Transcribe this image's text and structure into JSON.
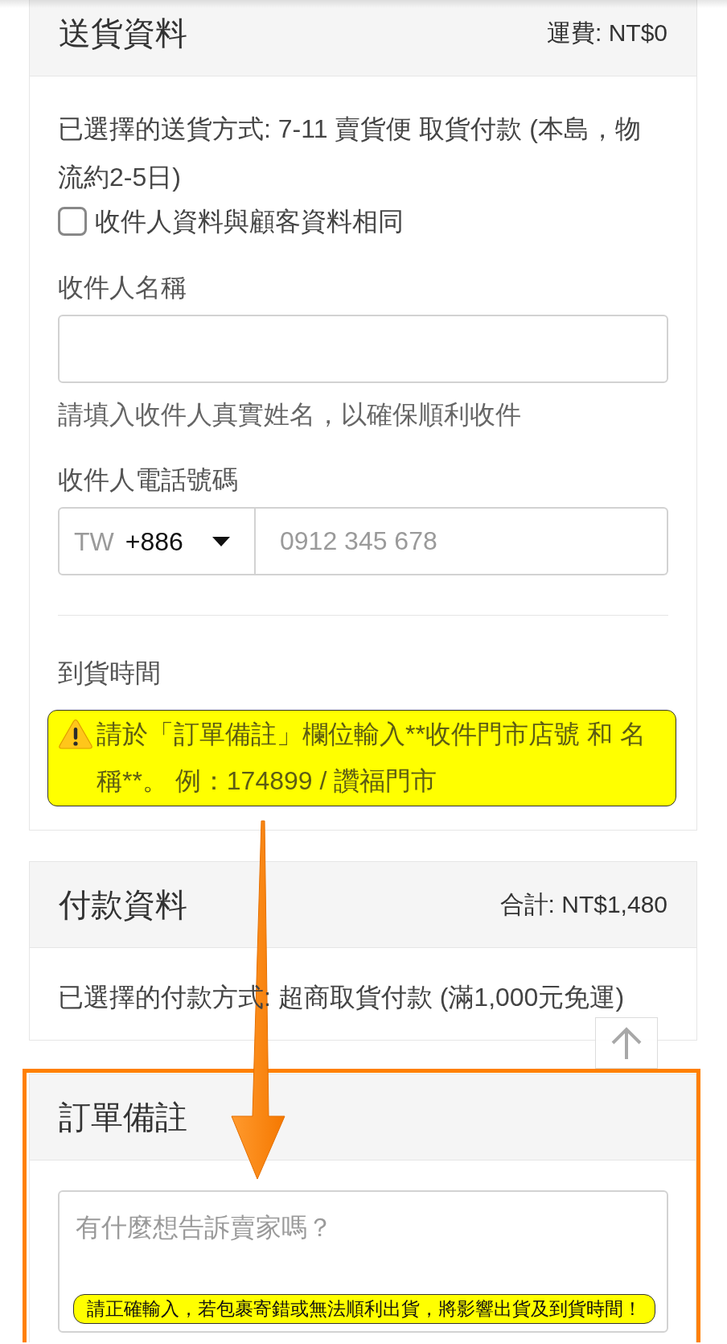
{
  "shipping": {
    "title": "送貨資料",
    "fee": "運費: NT$0",
    "method": "已選擇的送貨方式: 7-11 賣貨便 取貨付款 (本島，物流約2-5日)",
    "same_as_customer": {
      "label": "收件人資料與顧客資料相同",
      "checked": false
    },
    "recipient_name": {
      "label": "收件人名稱",
      "hint": "請填入收件人真實姓名，以確保順利收件"
    },
    "recipient_phone": {
      "label": "收件人電話號碼",
      "country": "TW",
      "dial_code": "+886",
      "placeholder": "0912 345 678"
    },
    "delivery_time": {
      "label": "到貨時間",
      "warning": "請於「訂單備註」欄位輸入**收件門市店號 和 名稱**。 例：174899 / 讚福門市"
    }
  },
  "payment": {
    "title": "付款資料",
    "total": "合計: NT$1,480",
    "method": "已選擇的付款方式: 超商取貨付款 (滿1,000元免運)"
  },
  "order_notes": {
    "title": "訂單備註",
    "placeholder": "有什麼想告訴賣家嗎？",
    "notice": "請正確輸入，若包裹寄錯或無法順利出貨，將影響出貨及到貨時間！",
    "highlighted": true
  }
}
